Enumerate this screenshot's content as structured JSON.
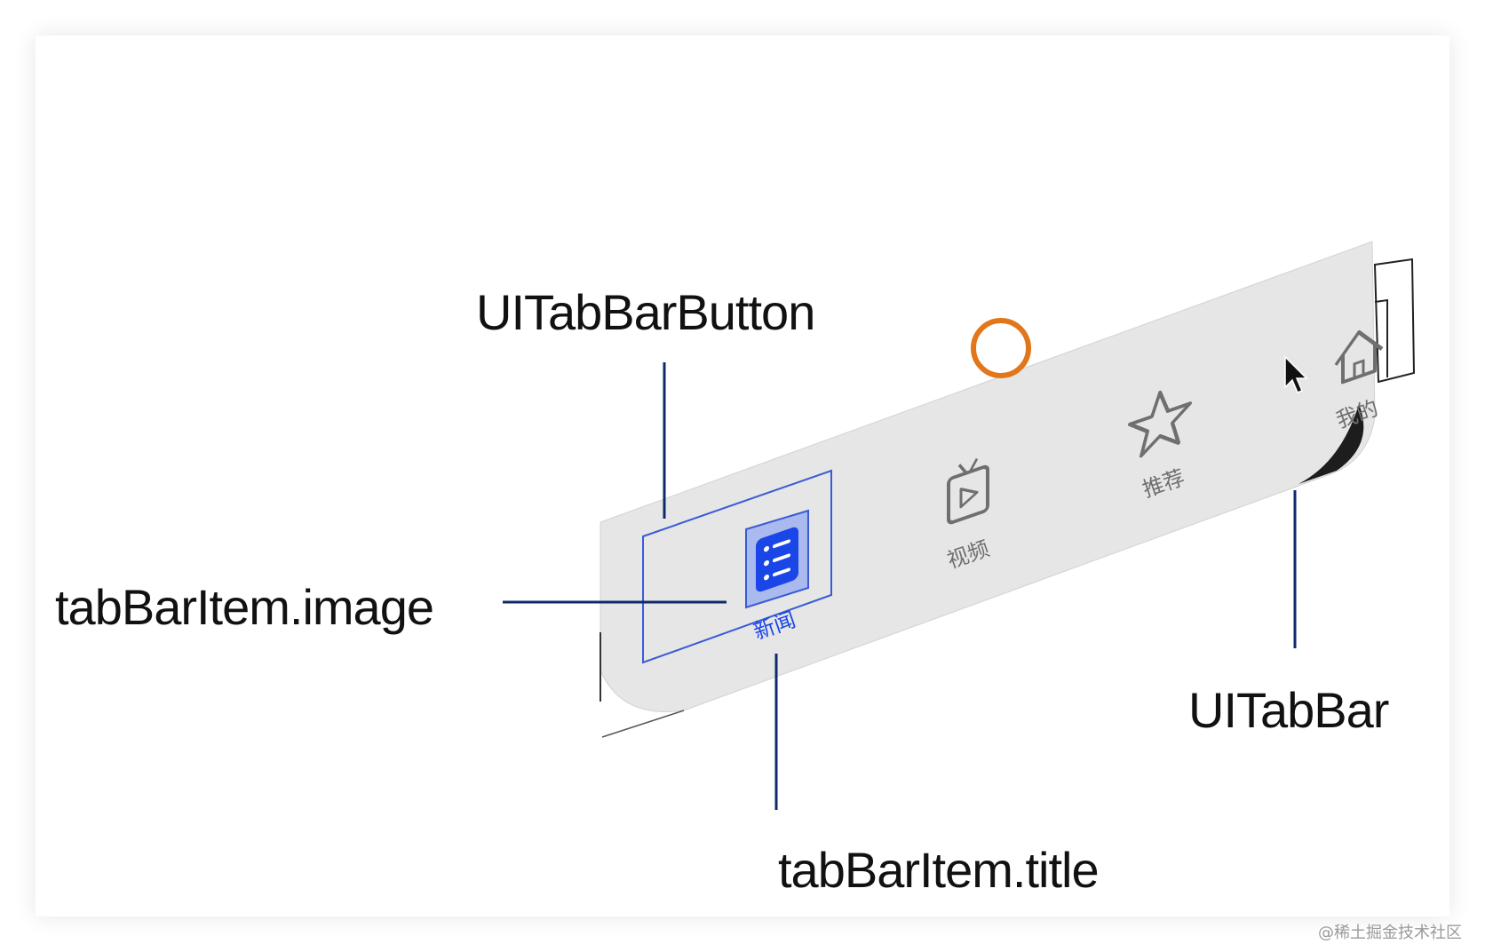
{
  "callouts": {
    "tab_bar_button": "UITabBarButton",
    "item_image": "tabBarItem.image",
    "item_title": "tabBarItem.title",
    "tab_bar": "UITabBar"
  },
  "tabs": [
    {
      "label": "新闻",
      "icon": "news-list-icon",
      "selected": true
    },
    {
      "label": "视频",
      "icon": "tv-play-icon",
      "selected": false
    },
    {
      "label": "推荐",
      "icon": "star-icon",
      "selected": false
    },
    {
      "label": "我的",
      "icon": "home-icon",
      "selected": false
    }
  ],
  "watermark": "@稀土掘金技术社区",
  "colors": {
    "tab_bar_fill": "#e6e6e6",
    "selected_tint": "#1a46e8",
    "unselected_tint": "#6f6f6f",
    "callout_line": "#0f2a6b",
    "highlight_frame": "#3a5bd4",
    "touch_indicator": "#e2761a"
  }
}
